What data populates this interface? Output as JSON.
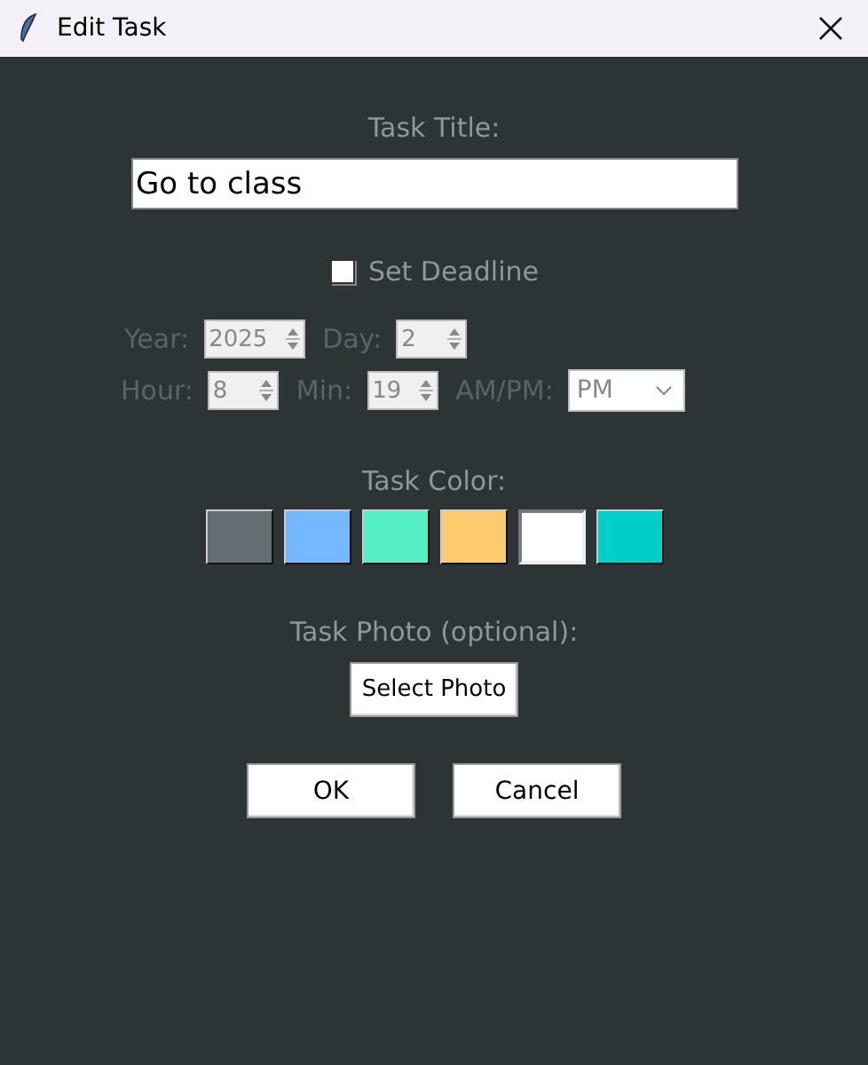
{
  "window": {
    "title": "Edit Task"
  },
  "title_field": {
    "label": "Task Title:",
    "value": "Go to class"
  },
  "deadline": {
    "label": "Set Deadline",
    "checked": false,
    "disabled": true,
    "rows": [
      [
        {
          "kind": "spin",
          "label": "Year:",
          "value": "2025"
        },
        {
          "kind": "spin",
          "label": "Day:",
          "value": "2"
        }
      ],
      [
        {
          "kind": "spin",
          "label": "Hour:",
          "value": "8"
        },
        {
          "kind": "spin",
          "label": "Min:",
          "value": "19"
        },
        {
          "kind": "combo",
          "label": "AM/PM:",
          "value": "PM"
        }
      ]
    ]
  },
  "task_color": {
    "label": "Task Color:",
    "swatches": [
      {
        "color": "#636e72",
        "selected": false
      },
      {
        "color": "#74b9ff",
        "selected": false
      },
      {
        "color": "#55efc4",
        "selected": false
      },
      {
        "color": "#fdcb6e",
        "selected": false
      },
      {
        "color": "#ffffff",
        "selected": true
      },
      {
        "color": "#00cec9",
        "selected": false
      }
    ]
  },
  "photo": {
    "label": "Task Photo (optional):",
    "button": "Select Photo"
  },
  "buttons": [
    "OK",
    "Cancel"
  ]
}
